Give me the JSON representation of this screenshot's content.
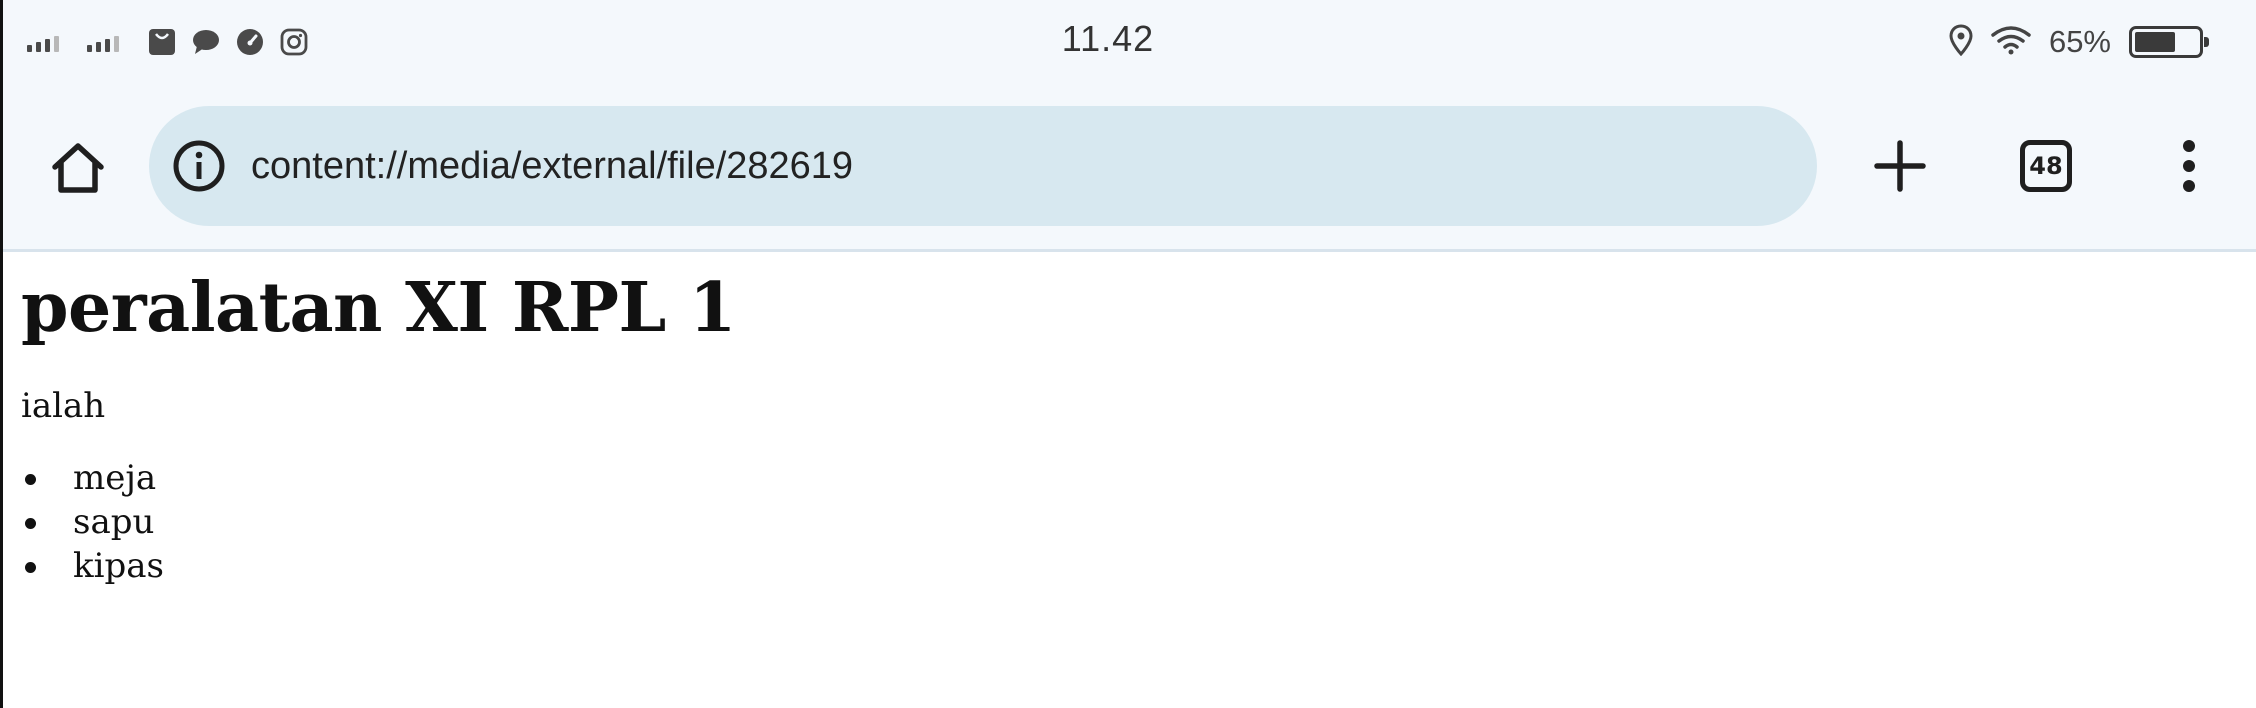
{
  "status_bar": {
    "time": "11.42",
    "battery_percent": "65%",
    "battery_level": 0.65,
    "notification_icons": [
      "signal-icon",
      "signal-icon",
      "shopping-bag-icon",
      "chat-bubble-icon",
      "speedometer-icon",
      "instagram-icon"
    ],
    "system_icons": [
      "location-icon",
      "wifi-icon",
      "battery-icon"
    ]
  },
  "browser": {
    "url": "content://media/external/file/282619",
    "tab_count": "48",
    "icons": [
      "home-icon",
      "info-icon",
      "plus-icon",
      "tab-switcher-icon",
      "more-vert-icon"
    ]
  },
  "page": {
    "title": "peralatan XI RPL 1",
    "paragraph": "ialah",
    "list_items": [
      "meja",
      "sapu",
      "kipas"
    ]
  },
  "colors": {
    "toolbar_bg": "#f4f8fc",
    "url_bar_bg": "#d7e8f0",
    "text": "#111111"
  }
}
